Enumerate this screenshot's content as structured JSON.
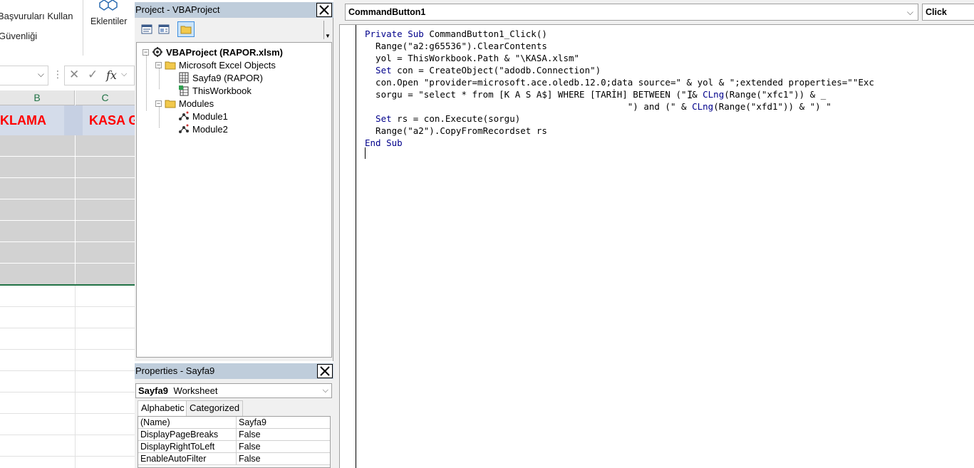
{
  "excel": {
    "ribbon": {
      "item1": "Başvuruları Kullan",
      "item2": "Güvenliği",
      "addins_label": "Eklentiler"
    },
    "formula_bar": {
      "fx_label": "fx"
    },
    "columns": [
      "B",
      "C"
    ],
    "title_cells": [
      "KLAMA",
      "KASA G"
    ]
  },
  "project_explorer": {
    "title": "Project - VBAProject",
    "tree": {
      "project": "VBAProject (RAPOR.xlsm)",
      "excel_objects_folder": "Microsoft Excel Objects",
      "sheet": "Sayfa9 (RAPOR)",
      "workbook": "ThisWorkbook",
      "modules_folder": "Modules",
      "module1": "Module1",
      "module2": "Module2"
    }
  },
  "properties": {
    "title": "Properties - Sayfa9",
    "object_name": "Sayfa9",
    "object_type": "Worksheet",
    "tabs": [
      "Alphabetic",
      "Categorized"
    ],
    "rows": [
      {
        "name": "(Name)",
        "value": "Sayfa9"
      },
      {
        "name": "DisplayPageBreaks",
        "value": "False"
      },
      {
        "name": "DisplayRightToLeft",
        "value": "False"
      },
      {
        "name": "EnableAutoFilter",
        "value": "False"
      }
    ]
  },
  "code_window": {
    "object_combo": "CommandButton1",
    "procedure_combo": "Click",
    "lines": [
      [
        [
          "kw",
          "Private Sub"
        ],
        [
          "",
          " CommandButton1_Click()"
        ]
      ],
      [
        [
          "",
          "  Range(\"a2:g65536\").ClearContents"
        ]
      ],
      [
        [
          "",
          "  yol = ThisWorkbook.Path & \"\\KASA.xlsm\""
        ]
      ],
      [
        [
          "kw",
          "  Set"
        ],
        [
          "",
          " con = CreateObject(\"adodb.Connection\")"
        ]
      ],
      [
        [
          "",
          "  con.Open \"provider=microsoft.ace.oledb.12.0;data source=\" & yol & \";extended properties=\"\"Exc"
        ]
      ],
      [
        [
          "",
          "  sorgu = \"select * from [K A S A$] WHERE [TARİH] BETWEEN (\" & "
        ],
        [
          "kw",
          "CLng"
        ],
        [
          "",
          "(Range(\"xfc1\")) & _"
        ]
      ],
      [
        [
          "",
          "                                                 \") and (\" & "
        ],
        [
          "kw",
          "CLng"
        ],
        [
          "",
          "(Range(\"xfd1\")) & \") \""
        ]
      ],
      [
        [
          "kw",
          "  Set"
        ],
        [
          "",
          " rs = con.Execute(sorgu)"
        ]
      ],
      [
        [
          "",
          "  Range(\"a2\").CopyFromRecordset rs"
        ]
      ],
      [
        [
          "kw",
          "End Sub"
        ]
      ]
    ]
  }
}
